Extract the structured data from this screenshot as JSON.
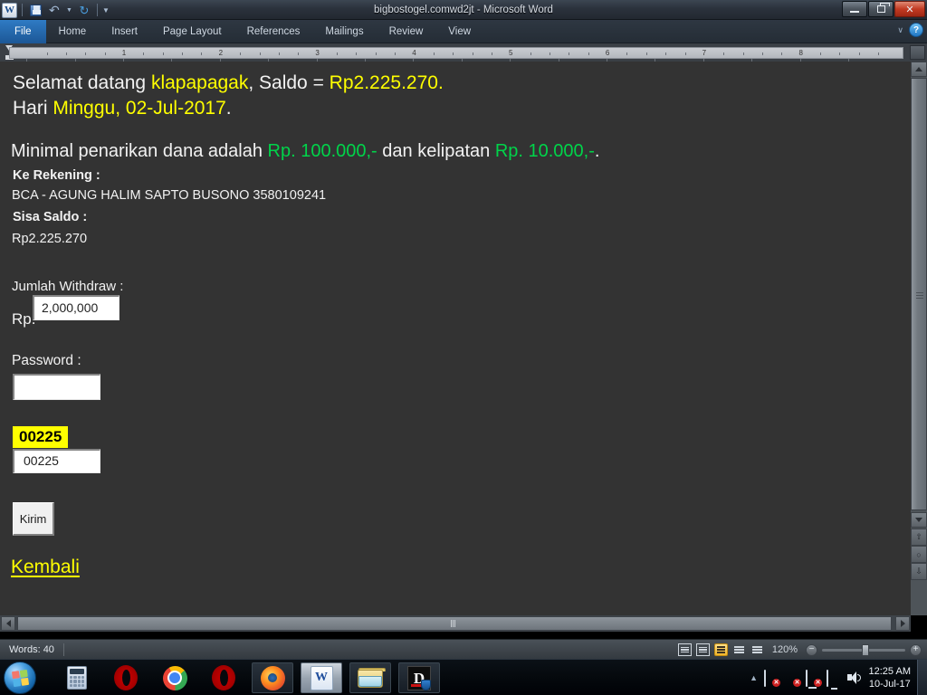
{
  "window": {
    "title": "bigbostogel.comwd2jt  -  Microsoft Word",
    "app_logo": "word-logo",
    "quick_access": [
      {
        "name": "save-icon",
        "label": "Save"
      },
      {
        "name": "undo-icon",
        "label": "Undo"
      },
      {
        "name": "redo-icon",
        "label": "Redo"
      },
      {
        "name": "customize-qat-icon",
        "label": "Customize Quick Access Toolbar"
      }
    ],
    "controls": {
      "minimize": "Minimize",
      "restore": "Restore Down",
      "close": "Close"
    }
  },
  "ribbon": {
    "tabs": [
      {
        "label": "File",
        "active": true
      },
      {
        "label": "Home",
        "active": false
      },
      {
        "label": "Insert",
        "active": false
      },
      {
        "label": "Page Layout",
        "active": false
      },
      {
        "label": "References",
        "active": false
      },
      {
        "label": "Mailings",
        "active": false
      },
      {
        "label": "Review",
        "active": false
      },
      {
        "label": "View",
        "active": false
      }
    ],
    "collapse_label": "∨",
    "help_label": "?"
  },
  "ruler": {
    "numbers": [
      "1",
      "2",
      "3",
      "4",
      "5",
      "6",
      "7",
      "8"
    ]
  },
  "document": {
    "greeting": {
      "prefix": "Selamat datang ",
      "username": "klapapagak",
      "middle": ", Saldo = ",
      "balance": "Rp2.225.270.",
      "day_prefix": "Hari ",
      "day_value": "Minggu, 02-Jul-2017",
      "day_suffix": "."
    },
    "minimum_notice": {
      "prefix": "Minimal penarikan dana adalah ",
      "min_amount": "Rp. 100.000,-",
      "middle": " dan kelipatan ",
      "multiple_amount": "Rp. 10.000,-",
      "suffix": "."
    },
    "account_label": "Ke Rekening :",
    "account_value": "BCA - AGUNG HALIM SAPTO BUSONO 3580109241",
    "balance_label": "Sisa Saldo :",
    "balance_value": "Rp2.225.270",
    "withdraw_label": "Jumlah Withdraw :",
    "currency_prefix": "Rp.",
    "withdraw_amount": "2,000,000",
    "password_label": "Password :",
    "password_value": "",
    "captcha_display": "00225",
    "captcha_input": "00225",
    "submit_label": "Kirim",
    "back_link": " Kembali"
  },
  "statusbar": {
    "words": "Words: 40",
    "view_icons": [
      {
        "name": "print-layout-view-icon",
        "active": false
      },
      {
        "name": "full-screen-reading-view-icon",
        "active": false
      },
      {
        "name": "web-layout-view-icon",
        "active": true
      },
      {
        "name": "outline-view-icon",
        "active": false
      },
      {
        "name": "draft-view-icon",
        "active": false
      }
    ],
    "zoom_level": "120%",
    "zoom_out": "−",
    "zoom_in": "+"
  },
  "taskbar": {
    "start_label": "Start",
    "items": [
      {
        "name": "taskbar-item-calculator",
        "label": "Calculator",
        "icon": "calculator-icon",
        "state": "pinned"
      },
      {
        "name": "taskbar-item-opera",
        "label": "Opera",
        "icon": "opera-icon",
        "state": "pinned"
      },
      {
        "name": "taskbar-item-chrome",
        "label": "Google Chrome",
        "icon": "chrome-icon",
        "state": "pinned"
      },
      {
        "name": "taskbar-item-opera-2",
        "label": "Opera",
        "icon": "opera-icon",
        "state": "pinned"
      },
      {
        "name": "taskbar-item-firefox",
        "label": "Mozilla Firefox",
        "icon": "firefox-icon",
        "state": "running"
      },
      {
        "name": "taskbar-item-word",
        "label": "Microsoft Word",
        "icon": "word-icon",
        "state": "active"
      },
      {
        "name": "taskbar-item-explorer",
        "label": "Windows Explorer",
        "icon": "folder-icon",
        "state": "running"
      },
      {
        "name": "taskbar-item-d-app",
        "label": "D",
        "icon": "d-app-icon",
        "state": "running"
      }
    ],
    "tray": [
      {
        "name": "action-center-icon",
        "label": "Action Center"
      },
      {
        "name": "avast-antivirus-icon",
        "label": "Avast Antivirus"
      },
      {
        "name": "network-icon",
        "label": "Network"
      },
      {
        "name": "display-icon",
        "label": "Display"
      },
      {
        "name": "volume-icon",
        "label": "Volume"
      }
    ],
    "clock_time": "12:25 AM",
    "clock_date": "10-Jul-17"
  },
  "colors": {
    "page_background": "#333333",
    "highlight_yellow": "#ffff00",
    "accent_green": "#00d44a",
    "text_white": "#f2f2f2",
    "file_tab_blue": "#1c5796",
    "close_button_red": "#c23a22"
  }
}
